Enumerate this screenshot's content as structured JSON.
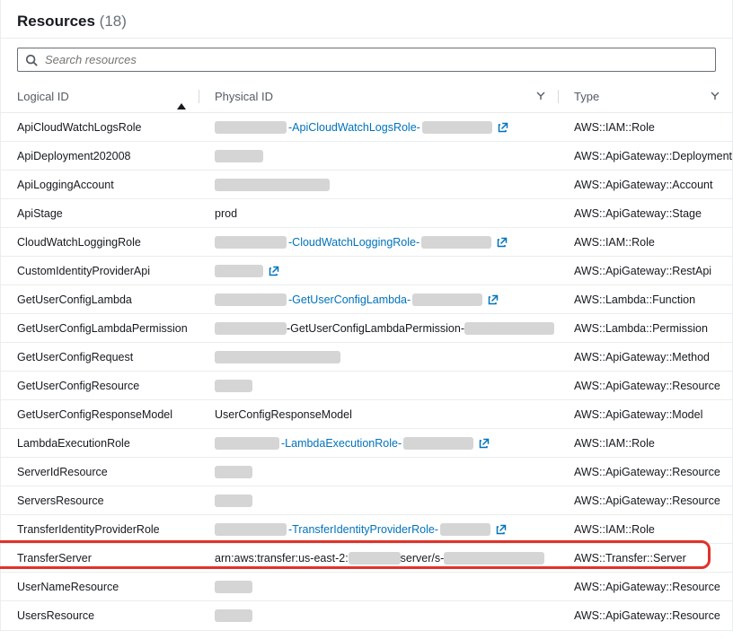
{
  "header": {
    "title": "Resources",
    "count": "(18)"
  },
  "search": {
    "placeholder": "Search resources"
  },
  "columns": {
    "logical": "Logical ID",
    "physical": "Physical ID",
    "type": "Type"
  },
  "rows": [
    {
      "logical": "ApiCloudWatchLogsRole",
      "type": "AWS::IAM::Role",
      "phys": {
        "style": "redact-link-redact-ext",
        "linkText": "-ApiCloudWatchLogsRole-",
        "r1": 80,
        "r2": 78
      }
    },
    {
      "logical": "ApiDeployment202008",
      "type": "AWS::ApiGateway::Deployment",
      "phys": {
        "style": "redact",
        "r1": 54
      }
    },
    {
      "logical": "ApiLoggingAccount",
      "type": "AWS::ApiGateway::Account",
      "phys": {
        "style": "redact",
        "r1": 128
      }
    },
    {
      "logical": "ApiStage",
      "type": "AWS::ApiGateway::Stage",
      "phys": {
        "style": "text",
        "text": "prod"
      }
    },
    {
      "logical": "CloudWatchLoggingRole",
      "type": "AWS::IAM::Role",
      "phys": {
        "style": "redact-link-redact-ext",
        "linkText": "-CloudWatchLoggingRole-",
        "r1": 80,
        "r2": 78
      }
    },
    {
      "logical": "CustomIdentityProviderApi",
      "type": "AWS::ApiGateway::RestApi",
      "phys": {
        "style": "redact-ext",
        "r1": 54
      }
    },
    {
      "logical": "GetUserConfigLambda",
      "type": "AWS::Lambda::Function",
      "phys": {
        "style": "redact-link-redact-ext",
        "linkText": "-GetUserConfigLambda-",
        "r1": 80,
        "r2": 78
      }
    },
    {
      "logical": "GetUserConfigLambdaPermission",
      "type": "AWS::Lambda::Permission",
      "phys": {
        "style": "redact-text-redact",
        "text": "-GetUserConfigLambdaPermission-",
        "r1": 80,
        "r2": 100
      }
    },
    {
      "logical": "GetUserConfigRequest",
      "type": "AWS::ApiGateway::Method",
      "phys": {
        "style": "redact",
        "r1": 140
      }
    },
    {
      "logical": "GetUserConfigResource",
      "type": "AWS::ApiGateway::Resource",
      "phys": {
        "style": "redact",
        "r1": 42
      }
    },
    {
      "logical": "GetUserConfigResponseModel",
      "type": "AWS::ApiGateway::Model",
      "phys": {
        "style": "text",
        "text": "UserConfigResponseModel"
      }
    },
    {
      "logical": "LambdaExecutionRole",
      "type": "AWS::IAM::Role",
      "phys": {
        "style": "redact-link-redact-ext",
        "linkText": "-LambdaExecutionRole-",
        "r1": 72,
        "r2": 78
      }
    },
    {
      "logical": "ServerIdResource",
      "type": "AWS::ApiGateway::Resource",
      "phys": {
        "style": "redact",
        "r1": 42
      }
    },
    {
      "logical": "ServersResource",
      "type": "AWS::ApiGateway::Resource",
      "phys": {
        "style": "redact",
        "r1": 42
      }
    },
    {
      "logical": "TransferIdentityProviderRole",
      "type": "AWS::IAM::Role",
      "phys": {
        "style": "redact-link-redact-ext",
        "linkText": "-TransferIdentityProviderRole-",
        "r1": 80,
        "r2": 56
      }
    },
    {
      "logical": "TransferServer",
      "type": "AWS::Transfer::Server",
      "highlight": true,
      "phys": {
        "style": "arn",
        "pre": "arn:aws:transfer:us-east-2:",
        "mid": "server/s-",
        "r1": 58,
        "r2": 112
      }
    },
    {
      "logical": "UserNameResource",
      "type": "AWS::ApiGateway::Resource",
      "phys": {
        "style": "redact",
        "r1": 42
      }
    },
    {
      "logical": "UsersResource",
      "type": "AWS::ApiGateway::Resource",
      "phys": {
        "style": "redact",
        "r1": 42
      }
    }
  ]
}
